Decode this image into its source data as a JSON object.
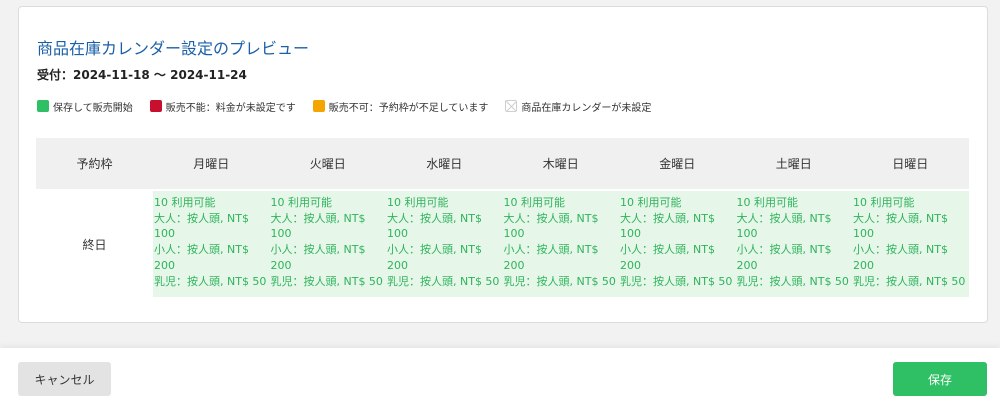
{
  "title": "商品在庫カレンダー設定のプレビュー",
  "period": "受付：2024-11-18 〜 2024-11-24",
  "legend": [
    {
      "label": "保存して販売開始",
      "color": "#2fbf64",
      "icon": "green-square"
    },
    {
      "label": "販売不能：料金が未設定です",
      "color": "#c8102e",
      "icon": "red-square"
    },
    {
      "label": "販売不可：予約枠が不足しています",
      "color": "#f5a500",
      "icon": "orange-square"
    },
    {
      "label": "商品在庫カレンダーが未設定",
      "color": "#ffffff",
      "icon": "empty-square"
    }
  ],
  "table": {
    "header_label": "予約枠",
    "days": [
      "月曜日",
      "火曜日",
      "水曜日",
      "木曜日",
      "金曜日",
      "土曜日",
      "日曜日"
    ],
    "row_label": "終日",
    "cell": {
      "availability": "10 利用可能",
      "adult": "大人：按人頭, NT$ 100",
      "child": "小人：按人頭, NT$ 200",
      "infant": "乳児：按人頭, NT$ 50"
    }
  },
  "footer": {
    "cancel_label": "キャンセル",
    "save_label": "保存"
  }
}
